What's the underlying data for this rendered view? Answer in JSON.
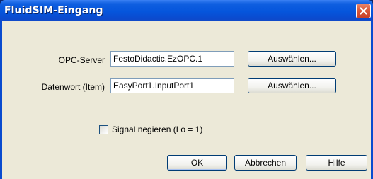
{
  "window": {
    "title": "FluidSIM-Eingang"
  },
  "form": {
    "opc_server": {
      "label": "OPC-Server",
      "value": "FestoDidactic.EzOPC.1",
      "button": "Auswählen..."
    },
    "data_word": {
      "label": "Datenwort (Item)",
      "value": "EasyPort1.InputPort1",
      "button": "Auswählen..."
    },
    "negate_signal": {
      "label": "Signal negieren (Lo = 1)",
      "checked": false
    }
  },
  "buttons": {
    "ok": "OK",
    "cancel": "Abbrechen",
    "help": "Hilfe"
  },
  "colors": {
    "title_bar": "#0555dc",
    "dialog_background": "#ece9d8",
    "close_button": "#d9593a"
  }
}
